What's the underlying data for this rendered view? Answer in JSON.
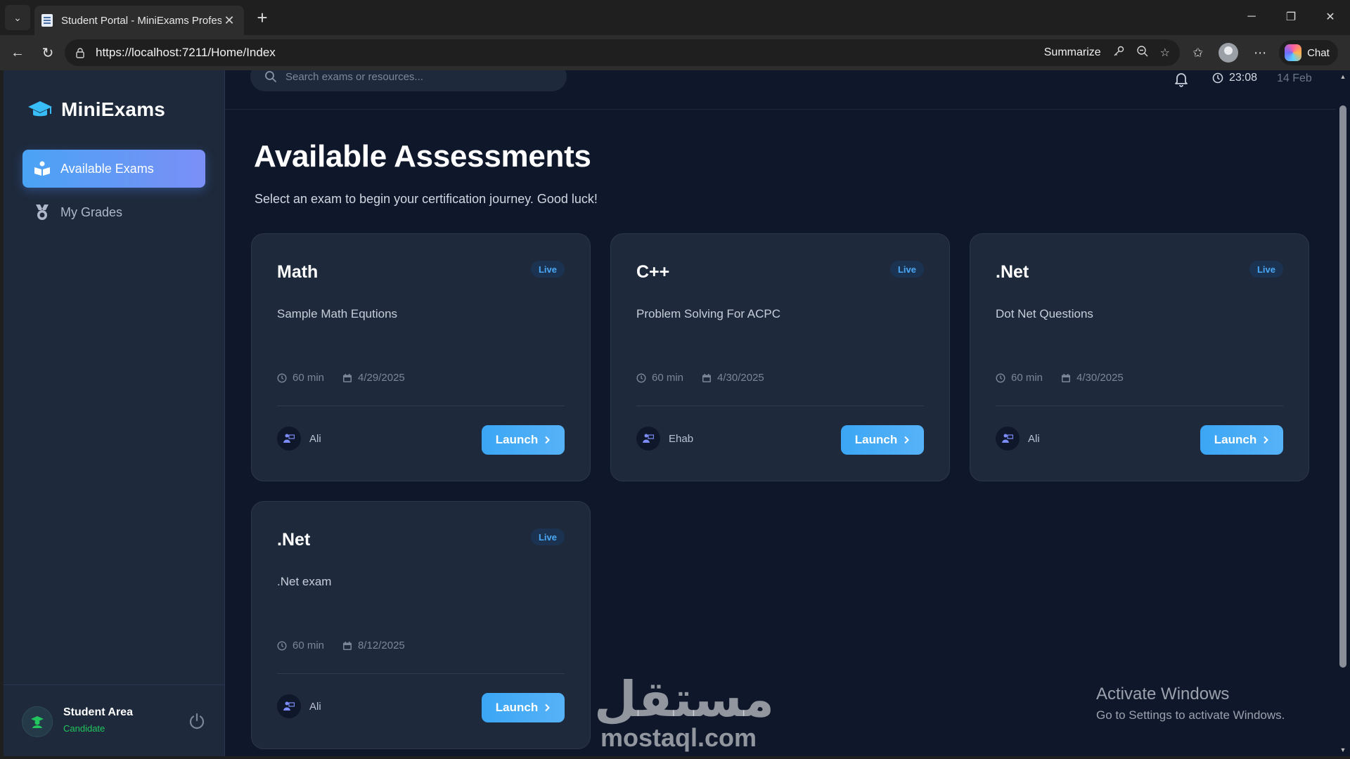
{
  "browser": {
    "tab_title": "Student Portal - MiniExams Profess",
    "url": "https://localhost:7211/Home/Index",
    "summarize_label": "Summarize",
    "chat_label": "Chat"
  },
  "sidebar": {
    "brand": "MiniExams",
    "nav": [
      {
        "label": "Available Exams",
        "icon": "book-reader-icon",
        "active": true
      },
      {
        "label": "My Grades",
        "icon": "medal-icon",
        "active": false
      }
    ],
    "footer": {
      "name": "Student Area",
      "role": "Candidate"
    }
  },
  "topbar": {
    "search_placeholder": "Search exams or resources...",
    "time": "23:08",
    "date": "14 Feb"
  },
  "main": {
    "title": "Available Assessments",
    "subtitle": "Select an exam to begin your certification journey. Good luck!",
    "cards": [
      {
        "title": "Math",
        "badge": "Live",
        "description": "Sample Math Equtions",
        "duration": "60 min",
        "date": "4/29/2025",
        "author": "Ali",
        "action": "Launch"
      },
      {
        "title": "C++",
        "badge": "Live",
        "description": "Problem Solving For ACPC",
        "duration": "60 min",
        "date": "4/30/2025",
        "author": "Ehab",
        "action": "Launch"
      },
      {
        "title": ".Net",
        "badge": "Live",
        "description": "Dot Net Questions",
        "duration": "60 min",
        "date": "4/30/2025",
        "author": "Ali",
        "action": "Launch"
      },
      {
        "title": ".Net",
        "badge": "Live",
        "description": ".Net exam",
        "duration": "60 min",
        "date": "8/12/2025",
        "author": "Ali",
        "action": "Launch"
      }
    ]
  },
  "watermark": {
    "arabic": "مستقل",
    "latin": "mostaql.com"
  },
  "os_notice": {
    "title": "Activate Windows",
    "subtitle": "Go to Settings to activate Windows."
  },
  "colors": {
    "accent": "#3ba6f5",
    "background": "#0f172a",
    "card": "#1e293b",
    "success": "#22c55e"
  }
}
